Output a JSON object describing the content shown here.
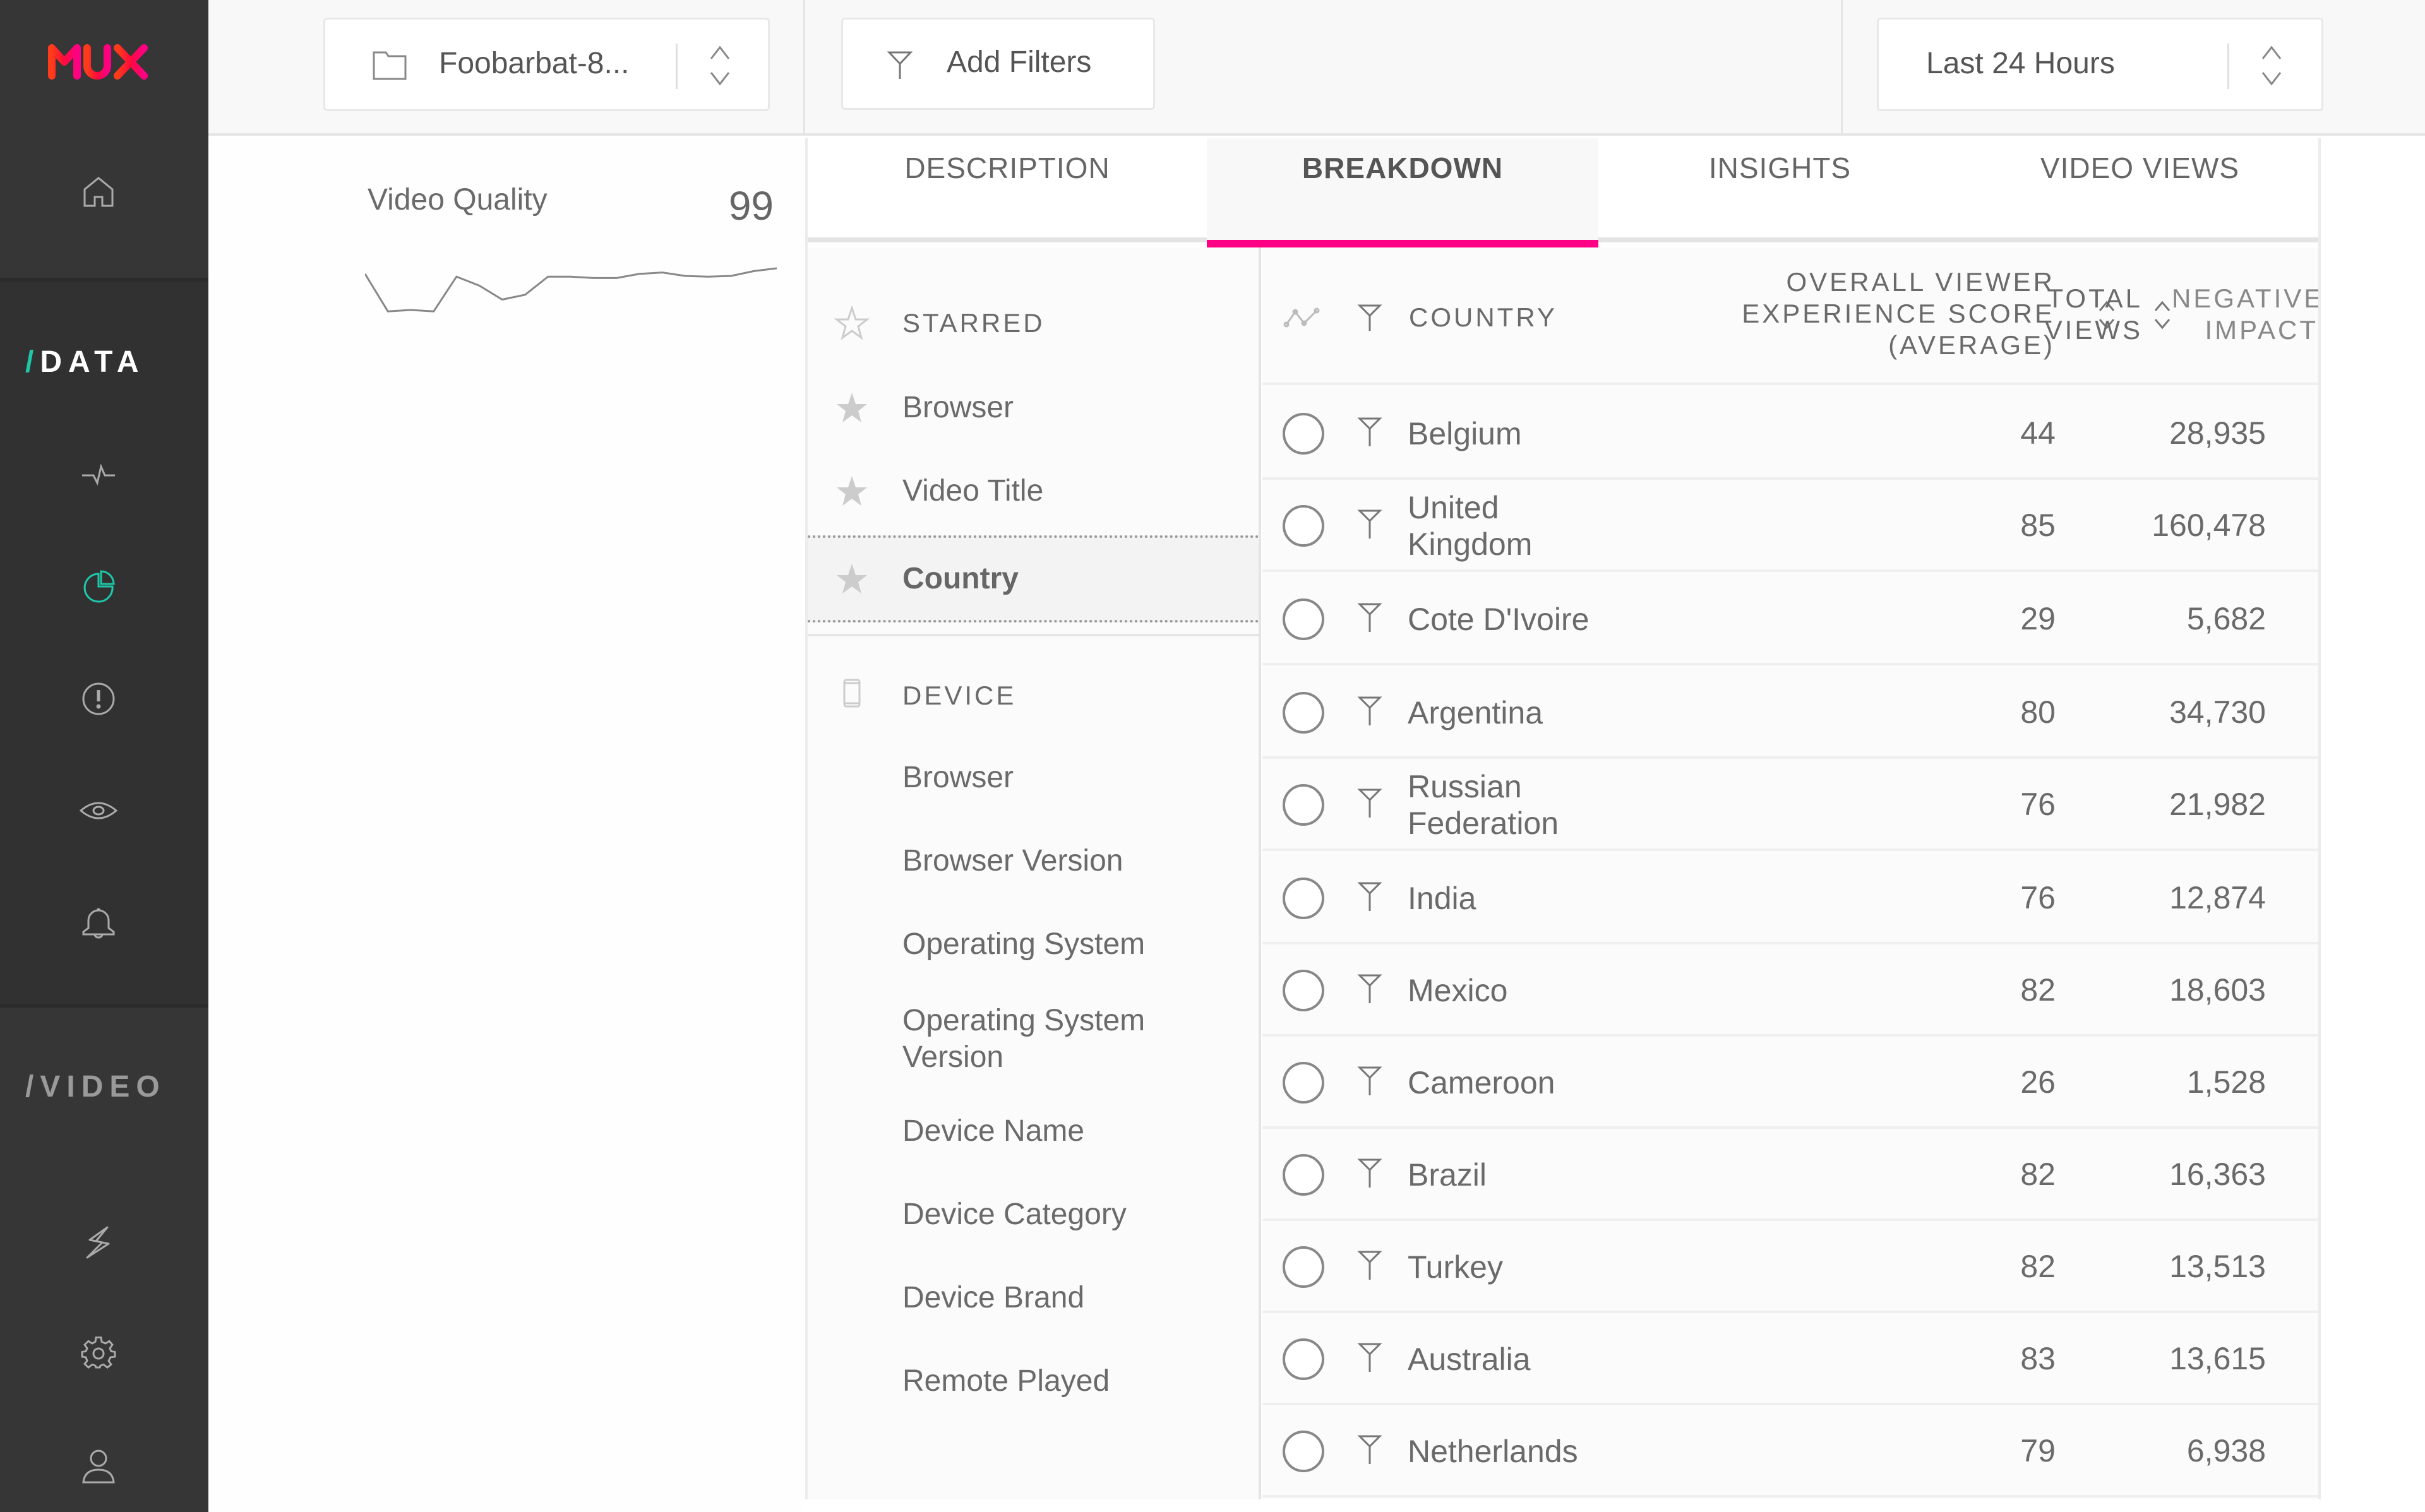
{
  "brand": {
    "logo_text": "MUX",
    "colors": {
      "logo_start": "#ff3c1a",
      "logo_mid": "#ff0a3c",
      "logo_end": "#ff0085",
      "accent_teal": "#1dc8a8",
      "tab_underline": "#ff0085"
    }
  },
  "sidebar": {
    "home_icon": "home-icon",
    "sections": [
      {
        "slash": "/",
        "label": "DATA",
        "active": true,
        "items": [
          {
            "name": "metrics",
            "icon": "pulse-icon"
          },
          {
            "name": "breakdown",
            "icon": "pie-chart-icon",
            "active": true
          },
          {
            "name": "errors",
            "icon": "alert-circle-icon"
          },
          {
            "name": "views",
            "icon": "eye-icon"
          },
          {
            "name": "alerts",
            "icon": "bell-icon"
          }
        ]
      },
      {
        "slash": "/",
        "label": "VIDEO",
        "active": false,
        "items": [
          {
            "name": "integrations",
            "icon": "lightning-icon"
          },
          {
            "name": "settings",
            "icon": "gear-icon"
          },
          {
            "name": "account",
            "icon": "user-icon"
          }
        ]
      }
    ]
  },
  "topbar": {
    "environment": {
      "value": "Foobarbat-8...",
      "icon": "folder-icon"
    },
    "filters": {
      "label": "Add Filters",
      "icon": "filter-icon"
    },
    "timeframe": {
      "value": "Last 24 Hours"
    }
  },
  "metric": {
    "title": "Video Quality",
    "value": "99",
    "sparkline": [
      82,
      28,
      30,
      28,
      78,
      65,
      45,
      52,
      78,
      78,
      76,
      76,
      82,
      84,
      79,
      78,
      79,
      86,
      90
    ]
  },
  "tabs": [
    {
      "label": "DESCRIPTION",
      "active": false
    },
    {
      "label": "BREAKDOWN",
      "active": true
    },
    {
      "label": "INSIGHTS",
      "active": false
    },
    {
      "label": "VIDEO VIEWS",
      "active": false
    }
  ],
  "dimensions": {
    "starred_header": "STARRED",
    "starred": [
      {
        "label": "Browser",
        "selected": false
      },
      {
        "label": "Video Title",
        "selected": false
      },
      {
        "label": "Country",
        "selected": true
      }
    ],
    "device_header": "DEVICE",
    "device": [
      {
        "label": "Browser"
      },
      {
        "label": "Browser Version"
      },
      {
        "label": "Operating System"
      },
      {
        "label": "Operating System Version"
      },
      {
        "label": "Device Name"
      },
      {
        "label": "Device Category"
      },
      {
        "label": "Device Brand"
      },
      {
        "label": "Remote Played"
      }
    ]
  },
  "table": {
    "headers": {
      "country": "COUNTRY",
      "score": "OVERALL VIEWER EXPERIENCE SCORE (AVERAGE)",
      "score_lines": [
        "OVERALL VIEWER",
        "EXPERIENCE SCORE",
        "(AVERAGE)"
      ],
      "views_lines": [
        "TOTAL",
        "VIEWS"
      ],
      "impact_lines": [
        "NEGATIVE",
        "IMPACT"
      ]
    },
    "rows": [
      {
        "country": "Belgium",
        "score": "44",
        "views": "28,935"
      },
      {
        "country": "United Kingdom",
        "score": "85",
        "views": "160,478"
      },
      {
        "country": "Cote D'Ivoire",
        "score": "29",
        "views": "5,682"
      },
      {
        "country": "Argentina",
        "score": "80",
        "views": "34,730"
      },
      {
        "country": "Russian Federation",
        "score": "76",
        "views": "21,982"
      },
      {
        "country": "India",
        "score": "76",
        "views": "12,874"
      },
      {
        "country": "Mexico",
        "score": "82",
        "views": "18,603"
      },
      {
        "country": "Cameroon",
        "score": "26",
        "views": "1,528"
      },
      {
        "country": "Brazil",
        "score": "82",
        "views": "16,363"
      },
      {
        "country": "Turkey",
        "score": "82",
        "views": "13,513"
      },
      {
        "country": "Australia",
        "score": "83",
        "views": "13,615"
      },
      {
        "country": "Netherlands",
        "score": "79",
        "views": "6,938"
      }
    ]
  }
}
